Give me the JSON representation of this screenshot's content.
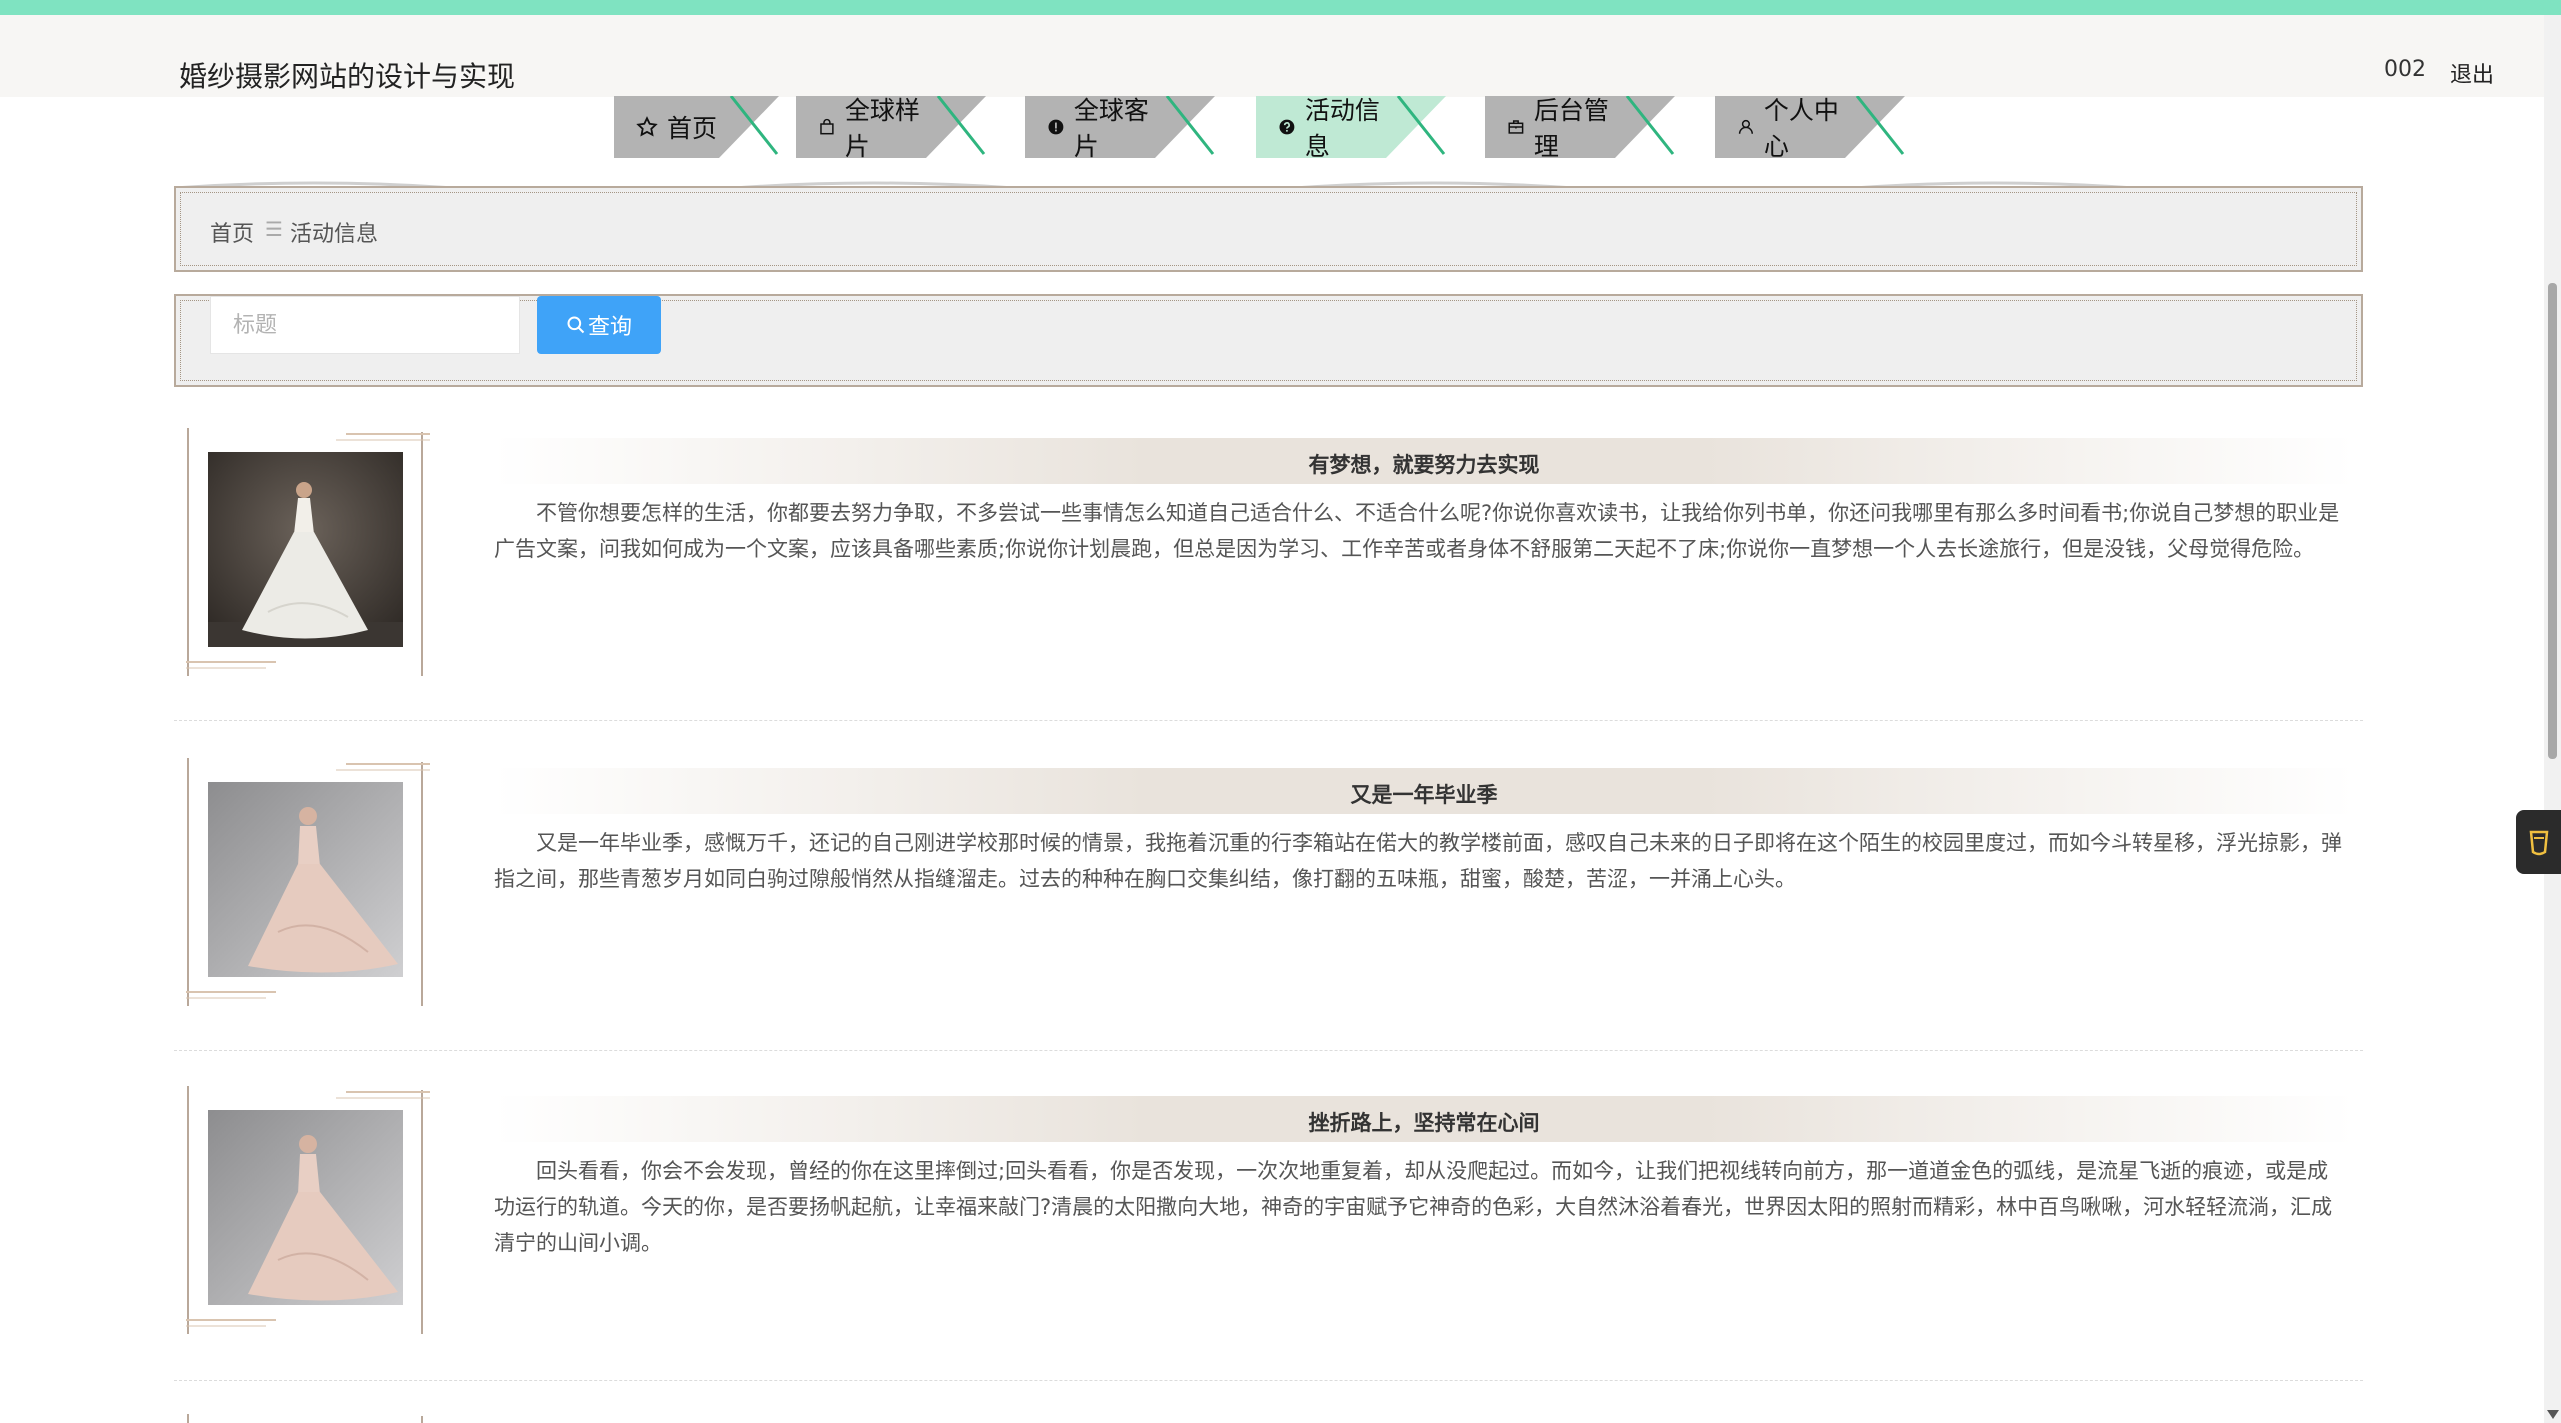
{
  "header": {
    "site_title": "婚纱摄影网站的设计与实现",
    "username": "002",
    "logout_label": "退出"
  },
  "nav": {
    "tabs": [
      {
        "label": "首页",
        "icon": "star-icon",
        "active": false
      },
      {
        "label": "全球样片",
        "icon": "bag-icon",
        "active": false
      },
      {
        "label": "全球客片",
        "icon": "exclamation-circle-icon",
        "active": false
      },
      {
        "label": "活动信息",
        "icon": "question-circle-icon",
        "active": true
      },
      {
        "label": "后台管理",
        "icon": "briefcase-icon",
        "active": false
      },
      {
        "label": "个人中心",
        "icon": "user-icon",
        "active": false
      }
    ]
  },
  "breadcrumb": {
    "home": "首页",
    "separator": "☰",
    "current": "活动信息"
  },
  "search": {
    "placeholder": "标题",
    "button_label": "查询",
    "value": ""
  },
  "articles": [
    {
      "title": "有梦想，就要努力去实现",
      "content": "不管你想要怎样的生活，你都要去努力争取，不多尝试一些事情怎么知道自己适合什么、不适合什么呢?你说你喜欢读书，让我给你列书单，你还问我哪里有那么多时间看书;你说自己梦想的职业是广告文案，问我如何成为一个文案，应该具备哪些素质;你说你计划晨跑，但总是因为学习、工作辛苦或者身体不舒服第二天起不了床;你说你一直梦想一个人去长途旅行，但是没钱，父母觉得危险。",
      "image": "bride-white-gown"
    },
    {
      "title": "又是一年毕业季",
      "content": "又是一年毕业季，感慨万千，还记的自己刚进学校那时候的情景，我拖着沉重的行李箱站在偌大的教学楼前面，感叹自己未来的日子即将在这个陌生的校园里度过，而如今斗转星移，浮光掠影，弹指之间，那些青葱岁月如同白驹过隙般悄然从指缝溜走。过去的种种在胸口交集纠结，像打翻的五味瓶，甜蜜，酸楚，苦涩，一并涌上心头。",
      "image": "bride-blush-gown"
    },
    {
      "title": "挫折路上，坚持常在心间",
      "content": "回头看看，你会不会发现，曾经的你在这里摔倒过;回头看看，你是否发现，一次次地重复着，却从没爬起过。而如今，让我们把视线转向前方，那一道道金色的弧线，是流星飞逝的痕迹，或是成功运行的轨道。今天的你，是否要扬帆起航，让幸福来敲门?清晨的太阳撒向大地，神奇的宇宙赋予它神奇的色彩，大自然沐浴着春光，世界因太阳的照射而精彩，林中百鸟啾啾，河水轻轻流淌，汇成清宁的山间小调。",
      "image": "bride-blush-gown"
    }
  ],
  "colors": {
    "top_strip": "#7fe3c1",
    "tab_inactive": "#b3b3b3",
    "tab_active": "#bfe9d4",
    "search_button": "#3fa3f8",
    "panel_border": "#b8aa9c"
  }
}
